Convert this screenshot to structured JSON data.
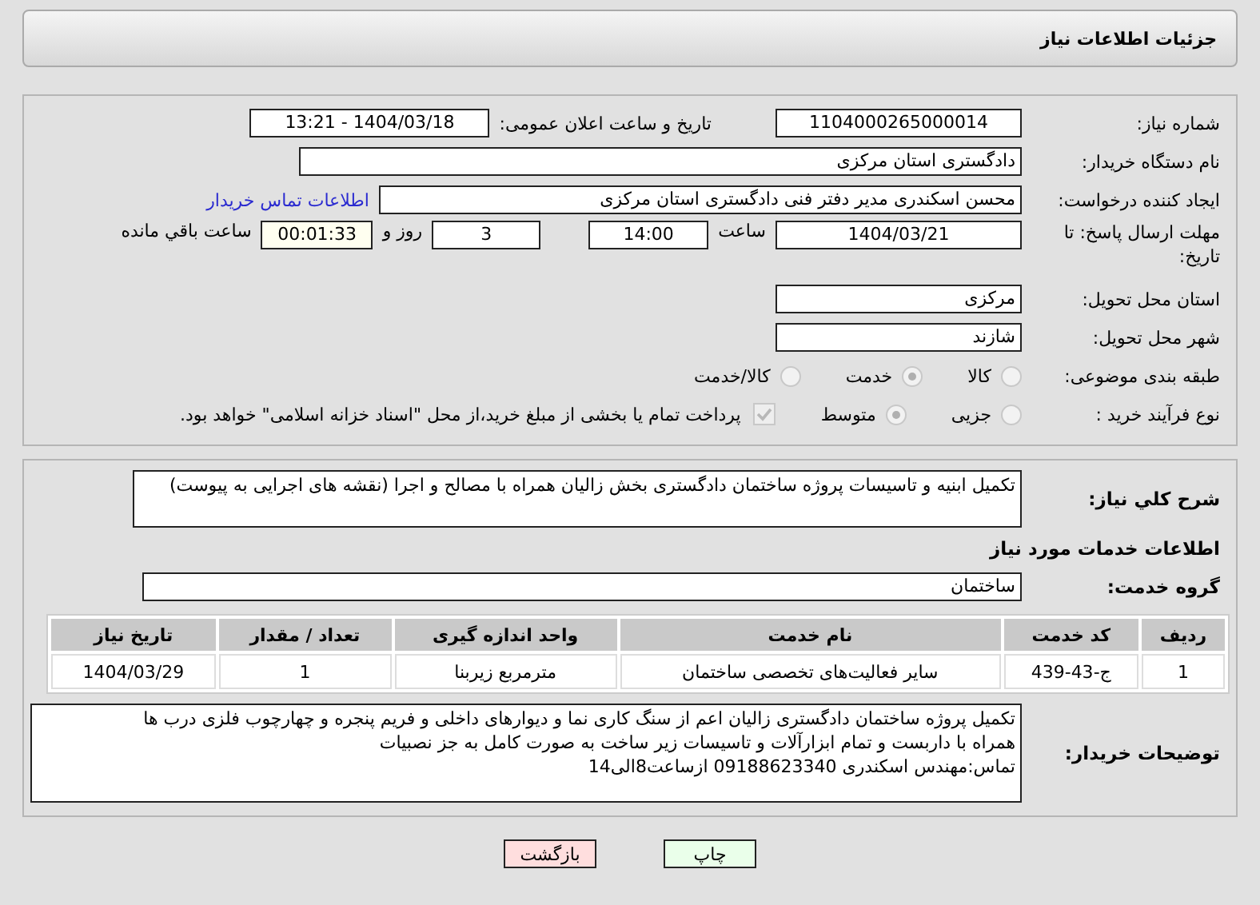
{
  "header": {
    "title": "جزئیات اطلاعات نیاز"
  },
  "need_number": {
    "label": "شماره نیاز:",
    "value": "1104000265000014"
  },
  "announce": {
    "label": "تاریخ و ساعت اعلان عمومی:",
    "value": "1404/03/18 - 13:21"
  },
  "buyer": {
    "label": "نام دستگاه خریدار:",
    "value": "دادگستری استان مرکزی"
  },
  "requester": {
    "label": "ایجاد کننده درخواست:",
    "value": "محسن اسکندری مدیر دفتر فنی دادگستری استان مرکزی",
    "link": "اطلاعات تماس خریدار"
  },
  "deadline": {
    "label": "مهلت ارسال پاسخ: تا تاریخ:",
    "date": "1404/03/21",
    "time_label": "ساعت",
    "time": "14:00",
    "days": "3",
    "days_label": "روز و",
    "remaining": "00:01:33",
    "remaining_label": "ساعت باقي مانده"
  },
  "province": {
    "label": "استان محل تحویل:",
    "value": "مرکزی"
  },
  "city": {
    "label": "شهر محل تحویل:",
    "value": "شازند"
  },
  "category": {
    "label": "طبقه بندی موضوعی:",
    "options": [
      {
        "label": "کالا",
        "selected": false
      },
      {
        "label": "خدمت",
        "selected": true
      },
      {
        "label": "کالا/خدمت",
        "selected": false
      }
    ]
  },
  "purchase_type": {
    "label": "نوع فرآیند خرید :",
    "options": [
      {
        "label": "جزیی",
        "selected": false
      },
      {
        "label": "متوسط",
        "selected": true
      }
    ],
    "payment": {
      "checked": true,
      "label": "پرداخت تمام یا بخشی از مبلغ خرید،از محل \"اسناد خزانه اسلامی\" خواهد بود."
    }
  },
  "summary": {
    "label": "شرح کلي نياز:",
    "value": "تکمیل ابنیه و تاسیسات پروژه ساختمان دادگستری بخش زالیان همراه با مصالح و اجرا (نقشه های اجرایی به پیوست)"
  },
  "services_heading": "اطلاعات خدمات مورد نیاز",
  "service_group": {
    "label": "گروه خدمت:",
    "value": "ساختمان"
  },
  "table": {
    "columns": [
      "ردیف",
      "کد خدمت",
      "نام خدمت",
      "واحد اندازه گیری",
      "تعداد / مقدار",
      "تاریخ نیاز"
    ],
    "rows": [
      [
        "1",
        "ج-43-439",
        "سایر فعالیت‌های تخصصی ساختمان",
        "مترمربع زیربنا",
        "1",
        "1404/03/29"
      ]
    ]
  },
  "notes": {
    "label": "توضیحات خریدار:",
    "lines": [
      "تکمیل پروژه ساختمان دادگستری زالیان اعم از سنگ کاری نما و دیوارهای داخلی و فریم پنجره و چهارچوب فلزی درب ها",
      "همراه با داربست و تمام ابزارآلات و تاسیسات زیر ساخت به صورت کامل به جز نصبیات",
      "تماس:مهندس اسکندری 09188623340 ازساعت8الی14"
    ]
  },
  "buttons": [
    {
      "kind": "print",
      "label": "چاپ"
    },
    {
      "kind": "back",
      "label": "بازگشت"
    }
  ]
}
